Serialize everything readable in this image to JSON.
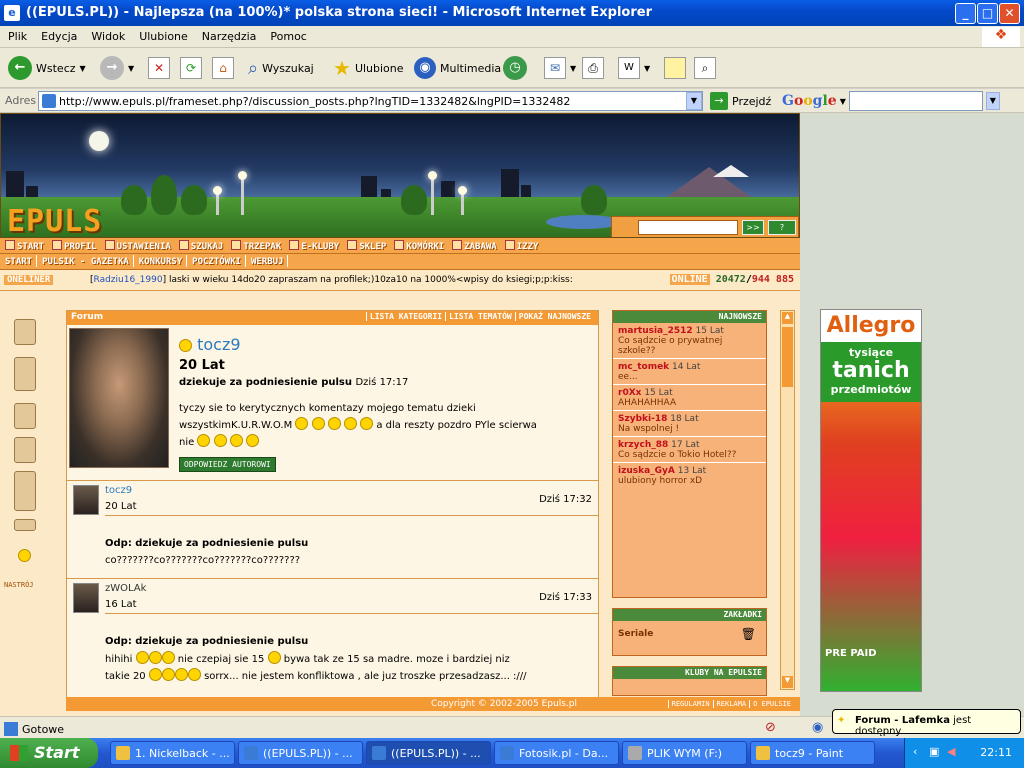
{
  "window": {
    "title": "((EPULS.PL)) - Najlepsza (na 100%)* polska strona sieci! - Microsoft Internet Explorer"
  },
  "menu": [
    "Plik",
    "Edycja",
    "Widok",
    "Ulubione",
    "Narzędzia",
    "Pomoc"
  ],
  "toolbar": {
    "back": "Wstecz",
    "search": "Wyszukaj",
    "favorites": "Ulubione",
    "media": "Multimedia"
  },
  "address": {
    "label": "Adres",
    "url": "http://www.epuls.pl/frameset.php?/discussion_posts.php?lngTID=1332482&lngPID=1332482",
    "go": "Przejdź",
    "google": "Google"
  },
  "site": {
    "logo": "EPULS",
    "nav1": [
      "START",
      "PROFIL",
      "USTAWIENIA",
      "SZUKAJ",
      "TRZEPAK",
      "E-KLUBY",
      "SKLEP",
      "KOMÓRKI",
      "ZABAWA",
      "IZZY"
    ],
    "nav2": [
      "START",
      "PULSIK - GAZETKA",
      "KONKURSY",
      "POCZTÓWKI",
      "WERBUJ"
    ],
    "oneliner": {
      "label": "ONELINER",
      "user": "Radziu16_1990",
      "message": "laski w wieku 14do20 zapraszam na profilek;)10za10 na 1000%<wpisy do ksiegi;p;p:kiss:"
    },
    "online": {
      "label": "ONLINE",
      "count": "20472",
      "total": "944 885"
    },
    "mood": "NASTRÓJ"
  },
  "forum": {
    "header": "Forum",
    "links": [
      "LISTA KATEGORII",
      "LISTA TEMATÓW",
      "POKAŻ NAJNOWSZE"
    ],
    "first": {
      "user": "tocz9",
      "age": "20 Lat",
      "title": "dziekuje za podniesienie pulsu",
      "date": "Dziś 17:17",
      "body1": "tyczy sie to kerytycznych komentazy mojego tematu dzieki",
      "body2": "wszystkimK.U.R.W.O.M",
      "body3": "a dla reszty pozdro PYle scierwa",
      "body4": "nie",
      "reply": "ODPOWIEDZ AUTOROWI"
    },
    "posts": [
      {
        "user": "tocz9",
        "age": "20 Lat",
        "date": "Dziś 17:32",
        "title": "Odp: dziekuje za podniesienie pulsu",
        "body": "co???????co???????co???????co???????"
      },
      {
        "user": "zWOLAk",
        "age": "16 Lat",
        "date": "Dziś 17:33",
        "title": "Odp: dziekuje za podniesienie pulsu",
        "body1": "hihihi",
        "body2": "nie czepiaj sie 15",
        "body3": "bywa tak ze 15 sa madre. moze i bardziej niz",
        "body4": "takie 20",
        "body5": "sorrx... nie jestem konfliktowa , ale juz troszke przesadzasz... :///"
      }
    ]
  },
  "newest": {
    "header": "NAJNOWSZE",
    "items": [
      {
        "user": "martusia_2512",
        "age": "15 Lat",
        "msg": "Co sądzcie o prywatnej szkole??"
      },
      {
        "user": "mc_tomek",
        "age": "14 Lat",
        "msg": "ee..."
      },
      {
        "user": "r0Xx",
        "age": "15 Lat",
        "msg": "AHAHAHHAA"
      },
      {
        "user": "Szybki-18",
        "age": "18 Lat",
        "msg": "Na wspolnej !"
      },
      {
        "user": "krzych_88",
        "age": "17 Lat",
        "msg": "Co sądzcie o Tokio Hotel??"
      },
      {
        "user": "izuska_GyA",
        "age": "13 Lat",
        "msg": "ulubiony horror xD"
      }
    ]
  },
  "bookmarks": {
    "header": "ZAKŁADKI",
    "item": "Seriale"
  },
  "clubs": {
    "header": "KLUBY NA EPULSIE"
  },
  "footer": {
    "copyright": "Copyright © 2002-2005 Epuls.pl",
    "links": [
      "REGULAMIN",
      "REKLAMA",
      "O EPULSIE"
    ]
  },
  "ad": {
    "brand": "Allegro",
    "l1": "tysiące",
    "l2": "tanich",
    "l3": "przedmiotów",
    "prepaid": "PRE PAID"
  },
  "status": {
    "text": "Gotowe",
    "notify_user": "Forum - Lafemka",
    "notify_text": "jest dostępny"
  },
  "taskbar": {
    "start": "Start",
    "clock": "22:11",
    "tasks": [
      "1. Nickelback - ...",
      "((EPULS.PL)) - ...",
      "((EPULS.PL)) - ...",
      "Fotosik.pl - Da...",
      "PLIK WYM (F:)",
      "tocz9 - Paint"
    ]
  }
}
